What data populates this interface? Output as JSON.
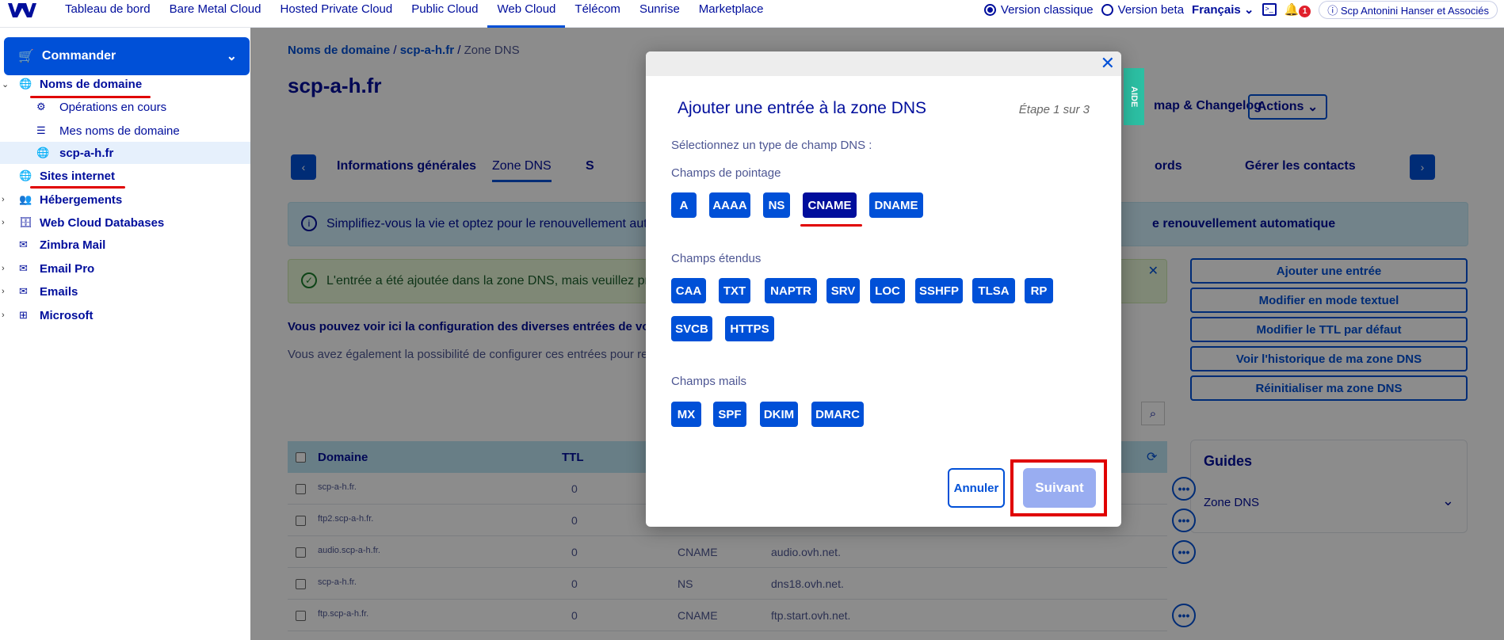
{
  "topnav": {
    "items": [
      "Tableau de bord",
      "Bare Metal Cloud",
      "Hosted Private Cloud",
      "Public Cloud",
      "Web Cloud",
      "Télécom",
      "Sunrise",
      "Marketplace"
    ],
    "active_index": 4,
    "version_classic": "Version classique",
    "version_beta": "Version beta",
    "language": "Français",
    "notif_count": "1",
    "account": "Scp Antonini Hanser et Associés"
  },
  "sidebar": {
    "commander": "Commander",
    "items": [
      {
        "label": "Noms de domaine",
        "icon": "globe-icon"
      },
      {
        "label": "Opérations en cours",
        "icon": "gear-icon"
      },
      {
        "label": "Mes noms de domaine",
        "icon": "list-icon"
      },
      {
        "label": "scp-a-h.fr",
        "icon": "globe-icon"
      },
      {
        "label": "Sites internet",
        "icon": "globe-icon"
      },
      {
        "label": "Hébergements",
        "icon": "users-icon"
      },
      {
        "label": "Web Cloud Databases",
        "icon": "database-icon"
      },
      {
        "label": "Zimbra Mail",
        "icon": "mail-icon"
      },
      {
        "label": "Email Pro",
        "icon": "mail-icon"
      },
      {
        "label": "Emails",
        "icon": "mail-icon"
      },
      {
        "label": "Microsoft",
        "icon": "windows-icon"
      }
    ]
  },
  "main": {
    "breadcrumb": [
      "Noms de domaine",
      "scp-a-h.fr",
      "Zone DNS"
    ],
    "title": "scp-a-h.fr",
    "roadmap": "map & Changelog",
    "actions": "Actions",
    "tabs": [
      "Informations générales",
      "Zone DNS",
      "S",
      "ords",
      "Gérer les contacts"
    ],
    "info_text": "Simplifiez-vous la vie et optez pour le renouvellement autom",
    "info_link": "e renouvellement automatique",
    "success_text": "L'entrée a été ajoutée dans la zone DNS, mais veuillez prend",
    "desc1": "Vous pouvez voir ici la configuration des diverses entrées de vot",
    "desc2": "Vous avez également la possibilité de configurer ces entrées pour re",
    "right_buttons": [
      "Ajouter une entrée",
      "Modifier en mode textuel",
      "Modifier le TTL par défaut",
      "Voir l'historique de ma zone DNS",
      "Réinitialiser ma zone DNS"
    ],
    "guides_title": "Guides",
    "guides_item": "Zone DNS",
    "table_headers": [
      "Domaine",
      "TTL"
    ],
    "rows": [
      {
        "domain": "scp-a-h.fr.",
        "ttl": "0",
        "type": "",
        "target": ""
      },
      {
        "domain": "ftp2.scp-a-h.fr.",
        "ttl": "0",
        "type": "",
        "target": ""
      },
      {
        "domain": "audio.scp-a-h.fr.",
        "ttl": "0",
        "type": "CNAME",
        "target": "audio.ovh.net."
      },
      {
        "domain": "scp-a-h.fr.",
        "ttl": "0",
        "type": "NS",
        "target": "dns18.ovh.net."
      },
      {
        "domain": "ftp.scp-a-h.fr.",
        "ttl": "0",
        "type": "CNAME",
        "target": "ftp.start.ovh.net."
      }
    ]
  },
  "modal": {
    "title": "Ajouter une entrée à la zone DNS",
    "step": "Étape 1 sur 3",
    "prompt": "Sélectionnez un type de champ DNS :",
    "group_pointage": "Champs de pointage",
    "pointage": [
      "A",
      "AAAA",
      "NS",
      "CNAME",
      "DNAME"
    ],
    "group_etendus": "Champs étendus",
    "etendus": [
      "CAA",
      "TXT",
      "NAPTR",
      "SRV",
      "LOC",
      "SSHFP",
      "TLSA",
      "RP",
      "SVCB",
      "HTTPS"
    ],
    "group_mails": "Champs mails",
    "mails": [
      "MX",
      "SPF",
      "DKIM",
      "DMARC"
    ],
    "selected": "CNAME",
    "cancel": "Annuler",
    "next": "Suivant",
    "aide": "AIDE"
  }
}
